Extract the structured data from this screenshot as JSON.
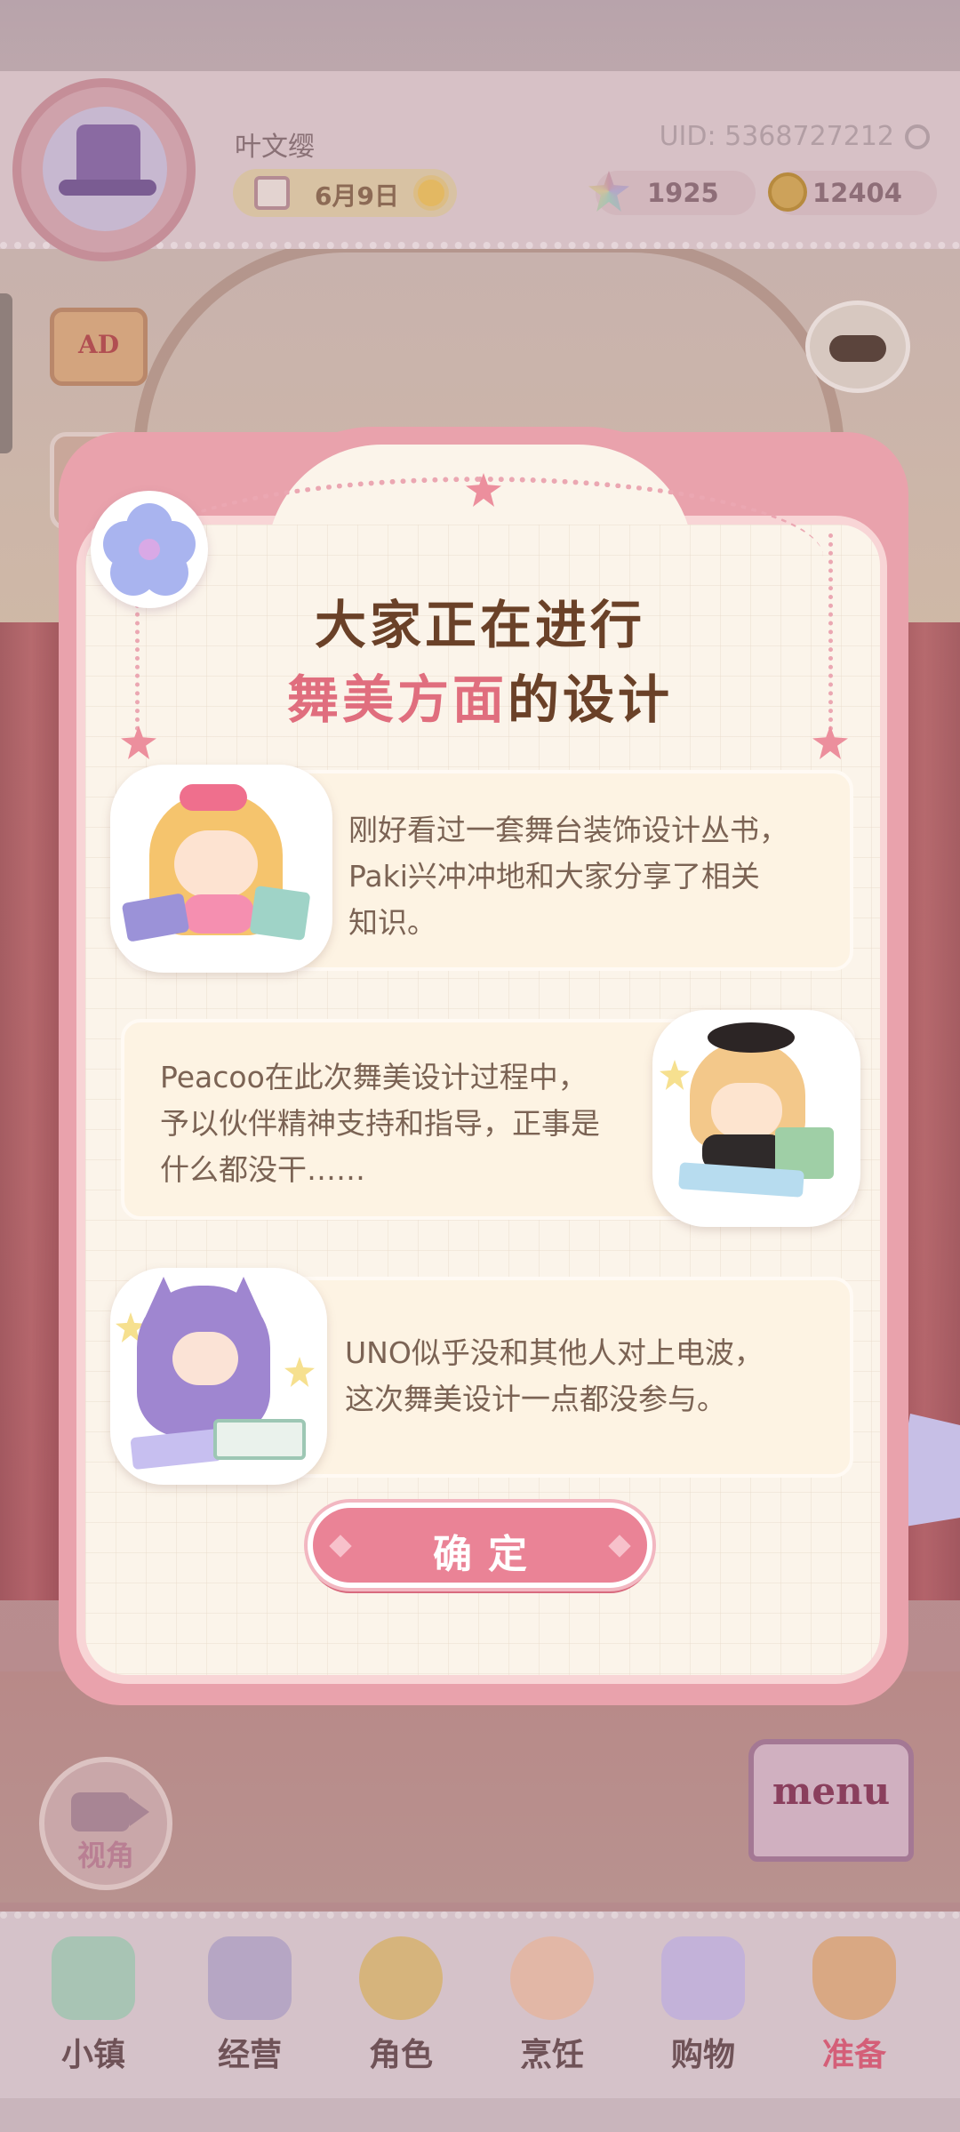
{
  "hud": {
    "username": "叶文缨",
    "uid": "UID: 5368727212",
    "date": "6月9日",
    "gems": "1925",
    "coins": "12404"
  },
  "side_buttons": {
    "ad_label": "AD"
  },
  "modal": {
    "title_line1": "大家正在进行",
    "title_line2_highlight": "舞美方面",
    "title_line2_rest": "的设计",
    "cards": [
      {
        "text": "刚好看过一套舞台装饰设计丛书，\nPaki兴冲冲地和大家分享了相关\n知识。"
      },
      {
        "text": "Peacoo在此次舞美设计过程中，\n予以伙伴精神支持和指导，正事是\n什么都没干……"
      },
      {
        "text": "UNO似乎没和其他人对上电波，\n这次舞美设计一点都没参与。"
      }
    ],
    "confirm_label": "确定"
  },
  "view_button_label": "视角",
  "menu_label": "menu",
  "nav": {
    "items": [
      {
        "label": "小镇",
        "icon": "map-icon",
        "active": false
      },
      {
        "label": "经营",
        "icon": "shop-bag-icon",
        "active": false
      },
      {
        "label": "角色",
        "icon": "character-icon",
        "active": false
      },
      {
        "label": "烹饪",
        "icon": "sandwich-icon",
        "active": false
      },
      {
        "label": "购物",
        "icon": "shopping-bag-icon",
        "active": false
      },
      {
        "label": "准备",
        "icon": "basket-icon",
        "active": true
      }
    ]
  },
  "colors": {
    "accent": "#e06e7e",
    "title_brown": "#6a4128",
    "button_pink": "#ea8396"
  }
}
